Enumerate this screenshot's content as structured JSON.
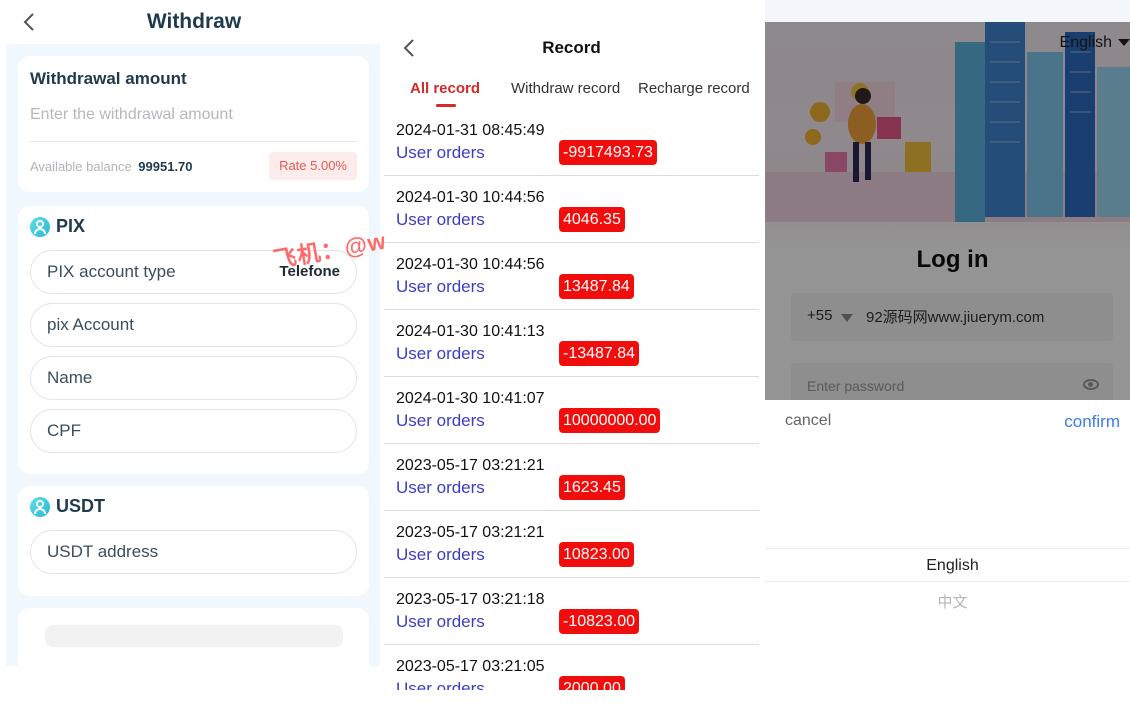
{
  "withdraw": {
    "title": "Withdraw",
    "amount_label": "Withdrawal amount",
    "amount_placeholder": "Enter the withdrawal amount",
    "available_label": "Available balance",
    "available_value": "99951.70",
    "rate": "Rate 5.00%",
    "pix": {
      "title": "PIX",
      "account_type_label": "PIX account type",
      "account_type_value": "Telefone",
      "account_placeholder": "pix Account",
      "name_placeholder": "Name",
      "cpf_placeholder": "CPF"
    },
    "usdt": {
      "title": "USDT",
      "address_placeholder": "USDT address"
    },
    "watermark": "飞机：@welunt"
  },
  "record": {
    "title": "Record",
    "tabs": [
      "All record",
      "Withdraw record",
      "Recharge record"
    ],
    "items": [
      {
        "date": "2024-01-31 08:45:49",
        "desc": "User orders",
        "amount": "-9917493.73"
      },
      {
        "date": "2024-01-30 10:44:56",
        "desc": "User orders",
        "amount": "4046.35"
      },
      {
        "date": "2024-01-30 10:44:56",
        "desc": "User orders",
        "amount": "13487.84"
      },
      {
        "date": "2024-01-30 10:41:13",
        "desc": "User orders",
        "amount": "-13487.84"
      },
      {
        "date": "2024-01-30 10:41:07",
        "desc": "User orders",
        "amount": "10000000.00"
      },
      {
        "date": "2023-05-17 03:21:21",
        "desc": "User orders",
        "amount": "1623.45"
      },
      {
        "date": "2023-05-17 03:21:21",
        "desc": "User orders",
        "amount": "10823.00"
      },
      {
        "date": "2023-05-17 03:21:18",
        "desc": "User orders",
        "amount": "-10823.00"
      },
      {
        "date": "2023-05-17 03:21:05",
        "desc": "User orders",
        "amount": "2000.00"
      }
    ]
  },
  "login": {
    "language": "English",
    "title": "Log in",
    "country_code": "+55",
    "phone_value": "92源码网www.jiuerym.com",
    "password_placeholder": "Enter password",
    "picker": {
      "cancel": "cancel",
      "confirm": "confirm",
      "options": [
        "English",
        "中文"
      ]
    }
  },
  "colors": {
    "accent_red": "#f20d0d",
    "link_blue": "#3d3dc4",
    "confirm_blue": "#3c7be8",
    "title_navy": "#1f3a4d"
  }
}
